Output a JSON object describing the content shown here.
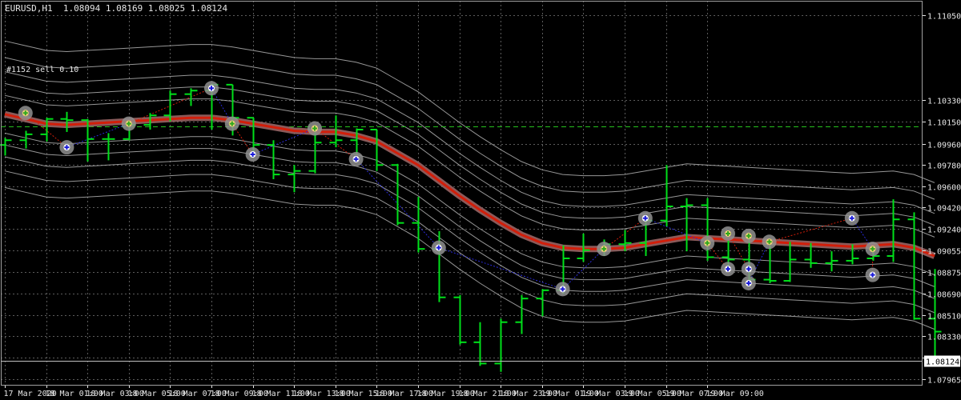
{
  "header": {
    "symbol": "EURUSD,H1",
    "ohlc": "1.08094 1.08169 1.08025 1.08124"
  },
  "trade_label": "#1152 sell 0.10",
  "colors": {
    "background": "#000000",
    "grid": "#5b5b5b",
    "candle": "#00e01a",
    "ma_core": "#d21e0a",
    "ma_outline": "#8a5a5a",
    "band": "#c8c8c8",
    "order_level": "#26c21e",
    "trade_line": "#2a2ad8",
    "marker_ring": "#909090",
    "price_box_bg": "#ffffff",
    "price_box_text": "#000000",
    "axis_text": "#e6e6e6"
  },
  "chart_data": {
    "type": "ohlc",
    "title": "EURUSD,H1",
    "x_ticks": [
      "17 Mar 2020",
      "18 Mar 01:00",
      "18 Mar 03:00",
      "18 Mar 05:00",
      "18 Mar 07:00",
      "18 Mar 09:00",
      "18 Mar 11:00",
      "18 Mar 13:00",
      "18 Mar 15:00",
      "18 Mar 17:00",
      "18 Mar 19:00",
      "18 Mar 21:00",
      "18 Mar 23:00",
      "19 Mar 01:00",
      "19 Mar 03:00",
      "19 Mar 05:00",
      "19 Mar 07:00",
      "19 Mar 09:00"
    ],
    "y_ticks": [
      "1.11050",
      "1.10330",
      "1.10150",
      "1.09960",
      "1.09780",
      "1.09600",
      "1.09420",
      "1.09240",
      "1.09055",
      "1.08875",
      "1.08690",
      "1.08510",
      "1.08330",
      "1.08150",
      "1.07965"
    ],
    "ylim": [
      1.0792,
      1.1117
    ],
    "current_price": "1.08124",
    "order_level": 1.1011,
    "candles": [
      {
        "o": 1.0995,
        "h": 1.1001,
        "l": 1.0986,
        "c": 1.0999
      },
      {
        "o": 1.0999,
        "h": 1.1007,
        "l": 1.0992,
        "c": 1.1004
      },
      {
        "o": 1.1004,
        "h": 1.1018,
        "l": 1.0998,
        "c": 1.1017
      },
      {
        "o": 1.1017,
        "h": 1.1023,
        "l": 1.1006,
        "c": 1.1016
      },
      {
        "o": 1.1016,
        "h": 1.1017,
        "l": 1.0981,
        "c": 1.1
      },
      {
        "o": 1.1,
        "h": 1.1005,
        "l": 1.0982,
        "c": 1.1
      },
      {
        "o": 1.1,
        "h": 1.1014,
        "l": 1.0999,
        "c": 1.1012
      },
      {
        "o": 1.1012,
        "h": 1.1022,
        "l": 1.1008,
        "c": 1.102
      },
      {
        "o": 1.102,
        "h": 1.1041,
        "l": 1.1015,
        "c": 1.1038
      },
      {
        "o": 1.1038,
        "h": 1.1043,
        "l": 1.1028,
        "c": 1.1041
      },
      {
        "o": 1.1041,
        "h": 1.1047,
        "l": 1.1008,
        "c": 1.1046
      },
      {
        "o": 1.1046,
        "h": 1.1046,
        "l": 1.1003,
        "c": 1.1018
      },
      {
        "o": 1.1018,
        "h": 1.1018,
        "l": 1.0986,
        "c": 1.0995
      },
      {
        "o": 1.0995,
        "h": 1.0999,
        "l": 1.0966,
        "c": 1.097
      },
      {
        "o": 1.097,
        "h": 1.0978,
        "l": 1.0955,
        "c": 1.0973
      },
      {
        "o": 1.0973,
        "h": 1.1012,
        "l": 1.0971,
        "c": 1.0997
      },
      {
        "o": 1.0997,
        "h": 1.102,
        "l": 1.0993,
        "c": 1.0999
      },
      {
        "o": 1.0999,
        "h": 1.1009,
        "l": 1.0987,
        "c": 1.1008
      },
      {
        "o": 1.1008,
        "h": 1.1008,
        "l": 1.0973,
        "c": 1.0978
      },
      {
        "o": 1.0978,
        "h": 1.0979,
        "l": 1.0927,
        "c": 1.0929
      },
      {
        "o": 1.0929,
        "h": 1.0951,
        "l": 1.0904,
        "c": 1.0907
      },
      {
        "o": 1.0907,
        "h": 1.0922,
        "l": 1.0862,
        "c": 1.0866
      },
      {
        "o": 1.0866,
        "h": 1.0868,
        "l": 1.0826,
        "c": 1.0828
      },
      {
        "o": 1.0828,
        "h": 1.0845,
        "l": 1.0808,
        "c": 1.081
      },
      {
        "o": 1.081,
        "h": 1.0848,
        "l": 1.0803,
        "c": 1.0845
      },
      {
        "o": 1.0845,
        "h": 1.0868,
        "l": 1.0835,
        "c": 1.0865
      },
      {
        "o": 1.0865,
        "h": 1.0873,
        "l": 1.085,
        "c": 1.0872
      },
      {
        "o": 1.0872,
        "h": 1.091,
        "l": 1.0869,
        "c": 1.0899
      },
      {
        "o": 1.0899,
        "h": 1.092,
        "l": 1.0896,
        "c": 1.0906
      },
      {
        "o": 1.0906,
        "h": 1.0915,
        "l": 1.0901,
        "c": 1.0911
      },
      {
        "o": 1.0911,
        "h": 1.0923,
        "l": 1.0905,
        "c": 1.0912
      },
      {
        "o": 1.0912,
        "h": 1.0934,
        "l": 1.0901,
        "c": 1.0931
      },
      {
        "o": 1.0931,
        "h": 1.0978,
        "l": 1.0926,
        "c": 1.0943
      },
      {
        "o": 1.0943,
        "h": 1.095,
        "l": 1.0905,
        "c": 1.0944
      },
      {
        "o": 1.0944,
        "h": 1.095,
        "l": 1.0897,
        "c": 1.09
      },
      {
        "o": 1.09,
        "h": 1.0914,
        "l": 1.0888,
        "c": 1.0898
      },
      {
        "o": 1.0898,
        "h": 1.0915,
        "l": 1.0878,
        "c": 1.0881
      },
      {
        "o": 1.0881,
        "h": 1.091,
        "l": 1.0878,
        "c": 1.088
      },
      {
        "o": 1.088,
        "h": 1.0913,
        "l": 1.0879,
        "c": 1.0898
      },
      {
        "o": 1.0898,
        "h": 1.0912,
        "l": 1.0891,
        "c": 1.0895
      },
      {
        "o": 1.0895,
        "h": 1.0905,
        "l": 1.0888,
        "c": 1.0897
      },
      {
        "o": 1.0897,
        "h": 1.0911,
        "l": 1.0894,
        "c": 1.0899
      },
      {
        "o": 1.0899,
        "h": 1.0906,
        "l": 1.0897,
        "c": 1.0901
      },
      {
        "o": 1.0901,
        "h": 1.0949,
        "l": 1.0896,
        "c": 1.0932
      },
      {
        "o": 1.0932,
        "h": 1.0938,
        "l": 1.0847,
        "c": 1.0848
      },
      {
        "o": 1.0848,
        "h": 1.089,
        "l": 1.081,
        "c": 1.0837
      }
    ],
    "ma": [
      1.1021,
      1.1017,
      1.1013,
      1.1012,
      1.1013,
      1.1014,
      1.1015,
      1.1016,
      1.1017,
      1.1018,
      1.1018,
      1.1016,
      1.1013,
      1.101,
      1.1007,
      1.1006,
      1.1006,
      1.1003,
      1.0998,
      1.0988,
      1.0978,
      1.0965,
      1.0952,
      1.094,
      1.0929,
      1.0919,
      1.0912,
      1.0908,
      1.0907,
      1.0907,
      1.0908,
      1.0911,
      1.0914,
      1.0917,
      1.0916,
      1.0915,
      1.0914,
      1.0913,
      1.0912,
      1.0911,
      1.091,
      1.0909,
      1.091,
      1.0911,
      1.0908,
      1.0901
    ],
    "band_offsets": [
      -0.0062,
      -0.0048,
      -0.0036,
      -0.0026,
      -0.0016,
      0.0016,
      0.0026,
      0.0036,
      0.0048,
      0.0062
    ],
    "trades": [
      {
        "i": 1,
        "p": 1.1022,
        "kind": "sell"
      },
      {
        "i": 3,
        "p": 1.0993,
        "kind": "buy"
      },
      {
        "i": 6,
        "p": 1.1013,
        "kind": "sell"
      },
      {
        "i": 10,
        "p": 1.1043,
        "kind": "buy"
      },
      {
        "i": 11,
        "p": 1.1013,
        "kind": "sell"
      },
      {
        "i": 12,
        "p": 1.0987,
        "kind": "buy"
      },
      {
        "i": 15,
        "p": 1.1009,
        "kind": "sell"
      },
      {
        "i": 17,
        "p": 1.0983,
        "kind": "buy"
      },
      {
        "i": 21,
        "p": 1.0908,
        "kind": "buy"
      },
      {
        "i": 27,
        "p": 1.0873,
        "kind": "buy"
      },
      {
        "i": 29,
        "p": 1.0907,
        "kind": "sell"
      },
      {
        "i": 31,
        "p": 1.0933,
        "kind": "buy"
      },
      {
        "i": 34,
        "p": 1.0912,
        "kind": "sell"
      },
      {
        "i": 35,
        "p": 1.089,
        "kind": "buy"
      },
      {
        "i": 35,
        "p": 1.092,
        "kind": "sell"
      },
      {
        "i": 36,
        "p": 1.089,
        "kind": "buy"
      },
      {
        "i": 36,
        "p": 1.0918,
        "kind": "sell"
      },
      {
        "i": 36,
        "p": 1.0878,
        "kind": "buy"
      },
      {
        "i": 37,
        "p": 1.0913,
        "kind": "sell"
      },
      {
        "i": 41,
        "p": 1.0933,
        "kind": "buy"
      },
      {
        "i": 42,
        "p": 1.0907,
        "kind": "sell"
      },
      {
        "i": 42,
        "p": 1.0885,
        "kind": "buy"
      }
    ]
  }
}
